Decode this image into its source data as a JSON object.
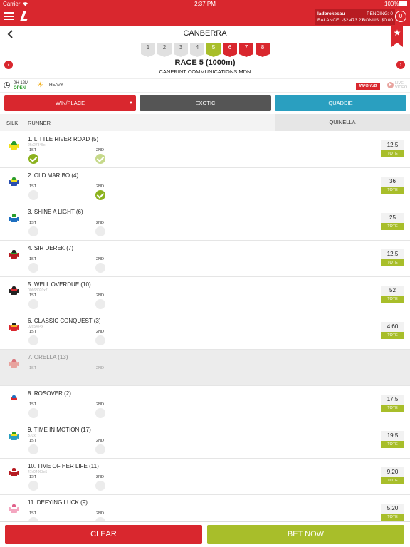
{
  "status_bar": {
    "carrier": "Carrier",
    "wifi_icon": "wifi-icon",
    "time": "2:37 PM",
    "battery": "100%"
  },
  "account": {
    "username": "ladbrokesau",
    "pending_label": "PENDING: 0",
    "balance_label": "BALANCE: -$2,473.27",
    "bonus_label": "BONUS: $0.00",
    "betslip_count": "0"
  },
  "header": {
    "venue": "CANBERRA",
    "favourite_icon": "star-icon"
  },
  "race_tabs": [
    {
      "label": "1",
      "state": "done"
    },
    {
      "label": "2",
      "state": "done"
    },
    {
      "label": "3",
      "state": "done"
    },
    {
      "label": "4",
      "state": "done"
    },
    {
      "label": "5",
      "state": "current"
    },
    {
      "label": "6",
      "state": "upcoming"
    },
    {
      "label": "7",
      "state": "upcoming"
    },
    {
      "label": "8",
      "state": "upcoming"
    }
  ],
  "race": {
    "title": "RACE 5 (1000m)",
    "subtitle": "CANPRINT COMMUNICATIONS MDN"
  },
  "info": {
    "time_to_start": "0H 12M",
    "status": "OPEN",
    "track": "HEAVY",
    "infohub": "INFOHUB",
    "live_video_line1": "LIVE",
    "live_video_line2": "VIDEO"
  },
  "bet_types": {
    "win_place": "WIN/PLACE",
    "exotic": "EXOTIC",
    "quaddie": "QUADDIE"
  },
  "table_header": {
    "silk": "SILK",
    "runner": "RUNNER",
    "market": "QUINELLA"
  },
  "runners": [
    {
      "name": "1. LITTLE RIVER ROAD (5)",
      "form": "26x27845x",
      "first": "1ST",
      "second": "2ND",
      "first_checked": true,
      "second_checked": "light",
      "odds": "12.5",
      "tote": "TOTE",
      "scratched": false,
      "silk": [
        "#f2e11c",
        "#2a9d2a",
        "#2a9d2a"
      ]
    },
    {
      "name": "2. OLD MARIBO (4)",
      "form": "",
      "first": "1ST",
      "second": "2ND",
      "first_checked": false,
      "second_checked": true,
      "odds": "36",
      "tote": "TOTE",
      "scratched": false,
      "silk": [
        "#2a4fb0",
        "#f2e11c",
        "#2a9d2a"
      ]
    },
    {
      "name": "3. SHINE A LIGHT (6)",
      "form": "",
      "first": "1ST",
      "second": "2ND",
      "first_checked": false,
      "second_checked": false,
      "odds": "25",
      "tote": "TOTE",
      "scratched": false,
      "silk": [
        "#1d6fc0",
        "#ffffff",
        "#2a9d2a"
      ]
    },
    {
      "name": "4. SIR DEREK (7)",
      "form": "",
      "first": "1ST",
      "second": "2ND",
      "first_checked": false,
      "second_checked": false,
      "odds": "12.5",
      "tote": "TOTE",
      "scratched": false,
      "silk": [
        "#b71c22",
        "#2a9d2a",
        "#222222"
      ]
    },
    {
      "name": "5. WELL OVERDUE (10)",
      "form": "00668020x7",
      "first": "1ST",
      "second": "2ND",
      "first_checked": false,
      "second_checked": false,
      "odds": "52",
      "tote": "TOTE",
      "scratched": false,
      "silk": [
        "#222222",
        "#d9272e",
        "#222222"
      ]
    },
    {
      "name": "6. CLASSIC CONQUEST (3)",
      "form": "02654x4x",
      "first": "1ST",
      "second": "2ND",
      "first_checked": false,
      "second_checked": false,
      "odds": "4.60",
      "tote": "TOTE",
      "scratched": false,
      "silk": [
        "#d9272e",
        "#f2b01e",
        "#222222"
      ]
    },
    {
      "name": "7. ORELLA (13)",
      "form": "",
      "first": "1ST",
      "second": "2ND",
      "first_checked": false,
      "second_checked": false,
      "odds": "",
      "tote": "",
      "scratched": true,
      "silk": [
        "#e8a39e",
        "#e8a39e",
        "#d9737a"
      ]
    },
    {
      "name": "8. ROSOVER (2)",
      "form": "",
      "first": "1ST",
      "second": "2ND",
      "first_checked": false,
      "second_checked": false,
      "odds": "17.5",
      "tote": "TOTE",
      "scratched": false,
      "silk": [
        "#ffffff",
        "#d9272e",
        "#1d6fc0"
      ]
    },
    {
      "name": "9. TIME IN MOTION (17)",
      "form": "370x",
      "first": "1ST",
      "second": "2ND",
      "first_checked": false,
      "second_checked": false,
      "odds": "19.5",
      "tote": "TOTE",
      "scratched": false,
      "silk": [
        "#2a9fc0",
        "#f2e11c",
        "#2a9d2a"
      ]
    },
    {
      "name": "10. TIME OF HER LIFE (11)",
      "form": "47x04063x5",
      "first": "1ST",
      "second": "2ND",
      "first_checked": false,
      "second_checked": false,
      "odds": "9.20",
      "tote": "TOTE",
      "scratched": false,
      "silk": [
        "#b71c22",
        "#ffffff",
        "#b71c22"
      ]
    },
    {
      "name": "11. DEFYING LUCK (9)",
      "form": "",
      "first": "1ST",
      "second": "2ND",
      "first_checked": false,
      "second_checked": false,
      "odds": "5.20",
      "tote": "TOTE",
      "scratched": false,
      "silk": [
        "#f4a6c0",
        "#ffffff",
        "#e0608a"
      ]
    }
  ],
  "footer": {
    "clear": "CLEAR",
    "bet_now": "BET NOW"
  }
}
